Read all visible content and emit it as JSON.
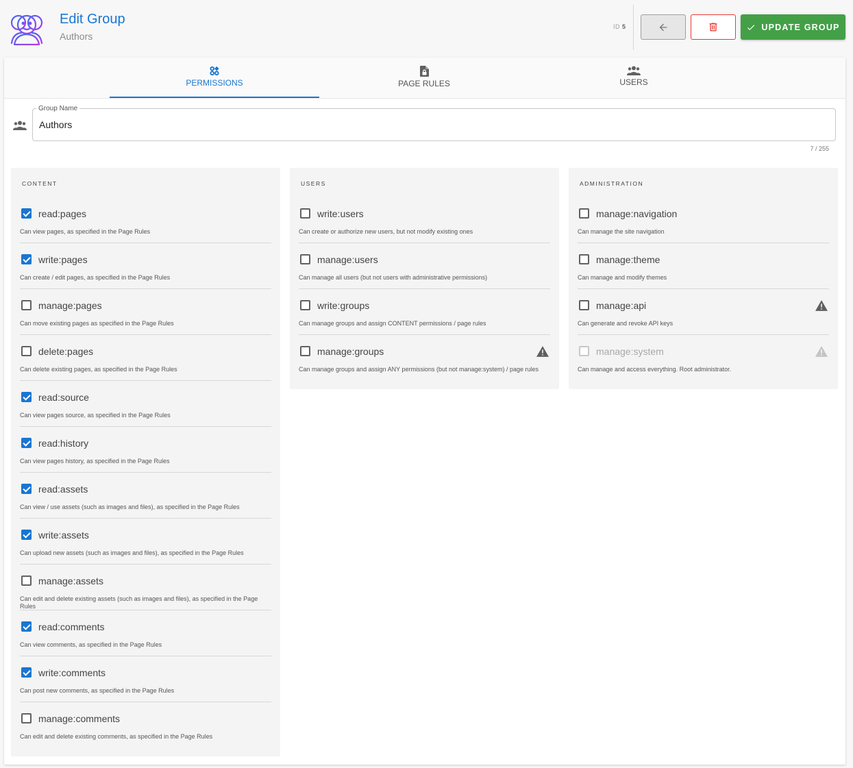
{
  "header": {
    "title": "Edit Group",
    "subtitle": "Authors",
    "id_label": "ID",
    "id_value": "5",
    "update_label": "UPDATE GROUP",
    "icons": {
      "back": "arrow-left-icon",
      "delete": "trash-icon",
      "update": "check-icon",
      "logo": "group-people-icon"
    },
    "colors": {
      "accent": "#1976d2",
      "update": "#43a047",
      "delete": "#e53935"
    }
  },
  "tabs": [
    {
      "label": "PERMISSIONS",
      "icon": "permissions-icon",
      "active": true
    },
    {
      "label": "PAGE RULES",
      "icon": "page-lock-icon",
      "active": false
    },
    {
      "label": "USERS",
      "icon": "users-icon",
      "active": false
    }
  ],
  "group_name": {
    "label": "Group Name",
    "value": "Authors",
    "counter": "7 / 255"
  },
  "columns": [
    {
      "title": "CONTENT",
      "items": [
        {
          "name": "read:pages",
          "desc": "Can view pages, as specified in the Page Rules",
          "checked": true
        },
        {
          "name": "write:pages",
          "desc": "Can create / edit pages, as specified in the Page Rules",
          "checked": true
        },
        {
          "name": "manage:pages",
          "desc": "Can move existing pages as specified in the Page Rules",
          "checked": false
        },
        {
          "name": "delete:pages",
          "desc": "Can delete existing pages, as specified in the Page Rules",
          "checked": false
        },
        {
          "name": "read:source",
          "desc": "Can view pages source, as specified in the Page Rules",
          "checked": true
        },
        {
          "name": "read:history",
          "desc": "Can view pages history, as specified in the Page Rules",
          "checked": true
        },
        {
          "name": "read:assets",
          "desc": "Can view / use assets (such as images and files), as specified in the Page Rules",
          "checked": true
        },
        {
          "name": "write:assets",
          "desc": "Can upload new assets (such as images and files), as specified in the Page Rules",
          "checked": true
        },
        {
          "name": "manage:assets",
          "desc": "Can edit and delete existing assets (such as images and files), as specified in the Page Rules",
          "checked": false
        },
        {
          "name": "read:comments",
          "desc": "Can view comments, as specified in the Page Rules",
          "checked": true
        },
        {
          "name": "write:comments",
          "desc": "Can post new comments, as specified in the Page Rules",
          "checked": true
        },
        {
          "name": "manage:comments",
          "desc": "Can edit and delete existing comments, as specified in the Page Rules",
          "checked": false
        }
      ]
    },
    {
      "title": "USERS",
      "items": [
        {
          "name": "write:users",
          "desc": "Can create or authorize new users, but not modify existing ones",
          "checked": false
        },
        {
          "name": "manage:users",
          "desc": "Can manage all users (but not users with administrative permissions)",
          "checked": false
        },
        {
          "name": "write:groups",
          "desc": "Can manage groups and assign CONTENT permissions / page rules",
          "checked": false
        },
        {
          "name": "manage:groups",
          "desc": "Can manage groups and assign ANY permissions (but not manage:system) / page rules",
          "checked": false,
          "warning": true
        }
      ]
    },
    {
      "title": "ADMINISTRATION",
      "items": [
        {
          "name": "manage:navigation",
          "desc": "Can manage the site navigation",
          "checked": false
        },
        {
          "name": "manage:theme",
          "desc": "Can manage and modify themes",
          "checked": false
        },
        {
          "name": "manage:api",
          "desc": "Can generate and revoke API keys",
          "checked": false,
          "warning": true
        },
        {
          "name": "manage:system",
          "desc": "Can manage and access everything. Root administrator.",
          "checked": false,
          "warning": true,
          "disabled": true
        }
      ]
    }
  ]
}
